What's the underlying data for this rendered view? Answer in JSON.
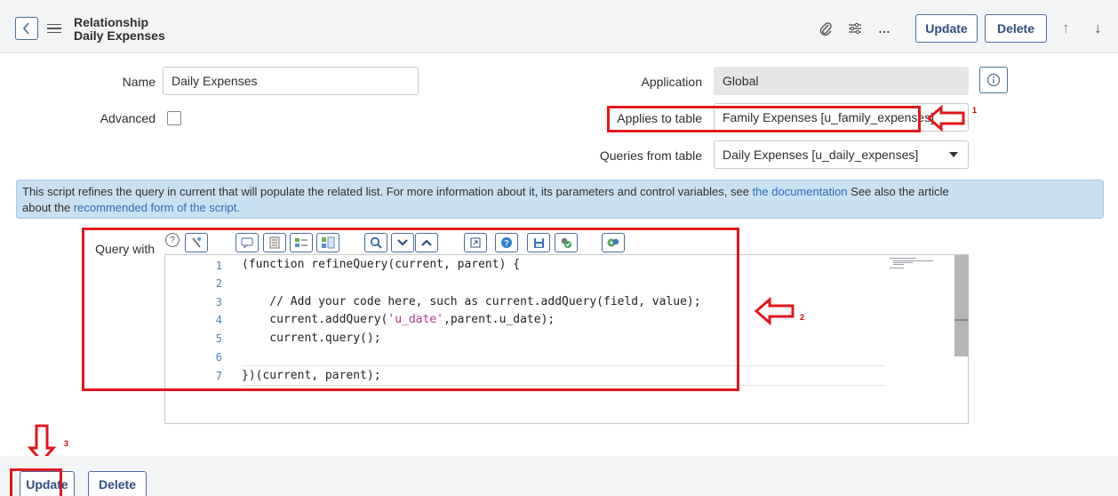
{
  "header": {
    "title_line1": "Relationship",
    "title_line2": "Daily Expenses",
    "update_label": "Update",
    "delete_label": "Delete",
    "more_label": "…",
    "up_glyph": "↑",
    "down_glyph": "↓",
    "back_glyph": "‹"
  },
  "form": {
    "name_label": "Name",
    "name_value": "Daily Expenses",
    "advanced_label": "Advanced",
    "application_label": "Application",
    "application_value": "Global",
    "applies_label": "Applies to table",
    "applies_value": "Family Expenses [u_family_expenses]",
    "queries_label": "Queries from table",
    "queries_value": "Daily Expenses [u_daily_expenses]"
  },
  "banner": {
    "text1": "This script refines the query in current that will populate the related list. For more information about it, its parameters and control variables, see ",
    "link1": "the documentation",
    "text2": " See also the article",
    "text3": "about the ",
    "link2": "recommended form of the script."
  },
  "editor": {
    "label": "Query with",
    "help_glyph": "?",
    "lines": [
      {
        "n": "1",
        "t": "(function refineQuery(current, parent) {"
      },
      {
        "n": "2",
        "t": ""
      },
      {
        "n": "3",
        "t": "    // Add your code here, such as current.addQuery(field, value);"
      },
      {
        "n": "4",
        "t": "    current.addQuery('u_date',parent.u_date);"
      },
      {
        "n": "5",
        "t": "    current.query();"
      },
      {
        "n": "6",
        "t": ""
      },
      {
        "n": "7",
        "t": "})(current, parent);"
      }
    ],
    "toolbar_icons": [
      "format-icon",
      "comment-icon",
      "toggle-comment-icon",
      "replace-icon",
      "replace-all-icon",
      "search-icon",
      "collapse-icon",
      "expand-icon",
      "fullscreen-icon",
      "help-icon",
      "save-icon",
      "validate-icon",
      "debug-icon"
    ]
  },
  "annotations": {
    "num1": "1",
    "num2": "2",
    "num3": "3",
    "color": "#e0161d"
  },
  "footer": {
    "update_label": "Update",
    "delete_label": "Delete"
  },
  "colors": {
    "button_border": "#4a6c9b",
    "link": "#2f6bb3",
    "banner_bg": "#c8e0f2"
  }
}
